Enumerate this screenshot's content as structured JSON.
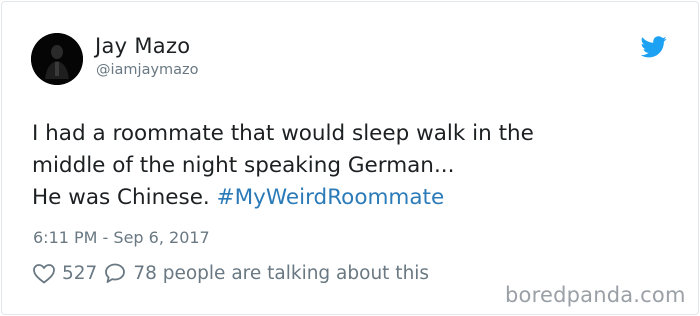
{
  "tweet": {
    "author_name": "Jay Mazo",
    "author_handle": "@iamjaymazo",
    "text_lines": [
      "I had a roommate that would sleep walk in the",
      "middle of the night speaking German...",
      "He was Chinese."
    ],
    "hashtag": "#MyWeirdRoommate",
    "timestamp": "6:11 PM - Sep 6, 2017",
    "likes": "527",
    "replies": "78 people are talking about this"
  },
  "icons": {
    "brand": "twitter-bird-icon",
    "like": "heart-icon",
    "reply": "speech-bubble-icon",
    "avatar": "avatar"
  },
  "colors": {
    "text": "#1c2022",
    "muted": "#697882",
    "hashtag": "#2b7bb9",
    "twitter_blue": "#1da1f2",
    "border": "#e1e8ed"
  },
  "watermark": "boredpanda.com"
}
